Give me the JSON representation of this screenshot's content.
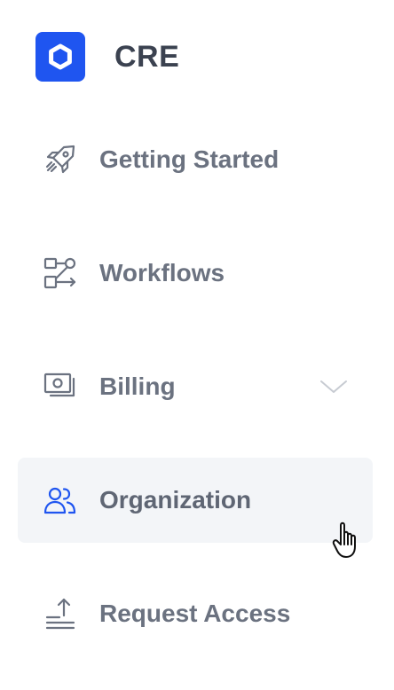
{
  "brand": {
    "name": "CRE",
    "accent_color": "#1f55f0",
    "logo_icon": "hexagon-icon"
  },
  "nav": {
    "items": [
      {
        "label": "Getting Started",
        "icon": "rocket-icon",
        "active": false
      },
      {
        "label": "Workflows",
        "icon": "workflow-icon",
        "active": false
      },
      {
        "label": "Billing",
        "icon": "billing-icon",
        "active": false,
        "expandable": true,
        "expand_icon": "chevron-down-icon"
      },
      {
        "label": "Organization",
        "icon": "users-icon",
        "active": true
      },
      {
        "label": "Request Access",
        "icon": "upload-icon",
        "active": false
      }
    ]
  },
  "colors": {
    "text": "#6b7280",
    "active_icon": "#1f55f0",
    "active_bg": "#f3f5f8"
  }
}
